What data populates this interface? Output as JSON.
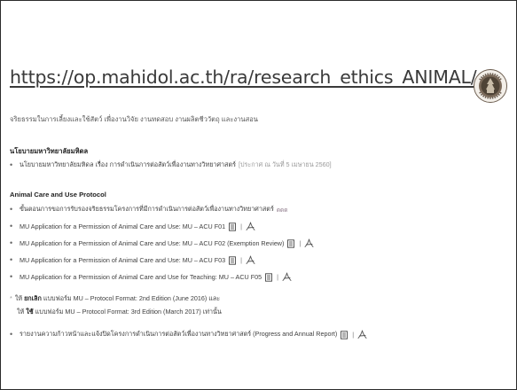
{
  "url": "https://op.mahidol.ac.th/ra/research_ethics_ANIMAL/",
  "header_line": "จริยธรรมในการเลี้ยงและใช้สัตว์ เพื่องานวิจัย งานทดสอบ งานผลิตชีววัตถุ และงานสอน",
  "policy": {
    "title": "นโยบายมหาวิทยาลัยมหิดล",
    "item_text": "นโยบายมหาวิทยาลัยมหิดล เรื่อง การดำเนินการต่อสัตว์เพื่องานทางวิทยาศาสตร์",
    "item_date": "[ประกาศ ณ วันที่ 5 เมษายน 2560]"
  },
  "protocol": {
    "title": "Animal Care and Use Protocol",
    "items": [
      {
        "text": "ขั้นตอนการขอการรับรองจริยธรรมโครงการที่มีการดำเนินการต่อสัตว์เพื่องานทางวิทยาศาสตร์",
        "tag": "ดดด"
      },
      {
        "text": "MU Application for a Permission of Animal Care and Use: MU – ACU F01"
      },
      {
        "text": "MU Application for a Permission of Animal Care and Use: MU – ACU F02 (Exemption Review)"
      },
      {
        "text": "MU Application for a Permission of Animal Care and Use: MU – ACU F03"
      },
      {
        "text": "MU Application for a Permission of Animal Care and Use for Teaching: MU – ACU F05"
      }
    ],
    "note_line1_prefix": "ให้",
    "note_line1_bold": "ยกเลิก",
    "note_line1_rest": "แบบฟอร์ม MU – Protocol Format: 2nd Edition (June 2016) และ",
    "note_line2_prefix": "ให้",
    "note_line2_bold": "ใช้",
    "note_line2_rest": "แบบฟอร์ม MU – Protocol Format: 3rd Edition (March 2017) เท่านั้น",
    "report_text": "รายงานความก้าวหน้าและแจ้งปิดโครงการดำเนินการต่อสัตว์เพื่องานทางวิทยาศาสตร์ (Progress and Annual Report)",
    "separator": "|"
  },
  "icons": {
    "seal": "mahidol-university-seal-icon",
    "doc": "document-icon",
    "pdf": "acrobat-pdf-icon"
  },
  "colors": {
    "url_text": "#3a3a3a",
    "body_text": "#3f3f3f",
    "date_gray": "#9a9a9a",
    "seal_brown": "#8a7a6a"
  }
}
